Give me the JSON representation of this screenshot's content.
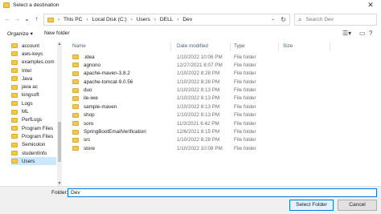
{
  "window": {
    "title": "Select a destination",
    "close_glyph": "✕"
  },
  "nav": {
    "back_glyph": "←",
    "forward_glyph": "→",
    "recent_glyph": "⌄",
    "up_glyph": "↑",
    "breadcrumb": [
      "This PC",
      "Local Disk (C:)",
      "Users",
      "DELL",
      "Dev"
    ],
    "separator": "›",
    "dropdown_glyph": "⌄",
    "refresh_glyph": "↻",
    "search_placeholder": "Search Dev",
    "search_glyph": "⌕"
  },
  "toolbar": {
    "organize_label": "Organize ▾",
    "new_folder_label": "New folder",
    "view_glyph": "☰▾",
    "help_glyph": "?"
  },
  "sidebar": {
    "items": [
      {
        "label": "account"
      },
      {
        "label": "aws-keys"
      },
      {
        "label": "examples.com"
      },
      {
        "label": "Intel"
      },
      {
        "label": "Java"
      },
      {
        "label": "java ac"
      },
      {
        "label": "kingsoft"
      },
      {
        "label": "Logs"
      },
      {
        "label": "ML"
      },
      {
        "label": "PerfLogs"
      },
      {
        "label": "Program Files"
      },
      {
        "label": "Program Files"
      },
      {
        "label": "Semicolon"
      },
      {
        "label": "studentInfo"
      },
      {
        "label": "Users"
      }
    ],
    "selected_index": 14
  },
  "columns": {
    "name": "Name",
    "date": "Date modified",
    "type": "Type",
    "size": "Size"
  },
  "files": [
    {
      "name": ".idea",
      "date": "1/10/2022 10:06 PM",
      "type": "File folder"
    },
    {
      "name": "agnono",
      "date": "12/27/2021 8:07 PM",
      "type": "File folder"
    },
    {
      "name": "apache-maven-3.8.2",
      "date": "1/10/2022 8:28 PM",
      "type": "File folder"
    },
    {
      "name": "apache-tomcat-9.0.56",
      "date": "1/10/2022 8:28 PM",
      "type": "File folder"
    },
    {
      "name": "duo",
      "date": "1/10/2022 8:13 PM",
      "type": "File folder"
    },
    {
      "name": "ile-iwe",
      "date": "1/10/2022 8:13 PM",
      "type": "File folder"
    },
    {
      "name": "sample-maven",
      "date": "1/10/2022 8:13 PM",
      "type": "File folder"
    },
    {
      "name": "shop",
      "date": "1/10/2022 8:13 PM",
      "type": "File folder"
    },
    {
      "name": "soro",
      "date": "11/3/2021 6:42 PM",
      "type": "File folder"
    },
    {
      "name": "SpringBootEmailVerification",
      "date": "12/6/2021 8:15 PM",
      "type": "File folder"
    },
    {
      "name": "src",
      "date": "1/10/2022 8:28 PM",
      "type": "File folder"
    },
    {
      "name": "store",
      "date": "1/10/2022 10:08 PM",
      "type": "File folder"
    }
  ],
  "bottom": {
    "folder_label": "Folder:",
    "folder_value": "Dev",
    "select_label": "Select Folder",
    "cancel_label": "Cancel"
  },
  "colors": {
    "selection": "#cce8ff",
    "accent": "#0078d7",
    "folder": "#f2c94c"
  }
}
